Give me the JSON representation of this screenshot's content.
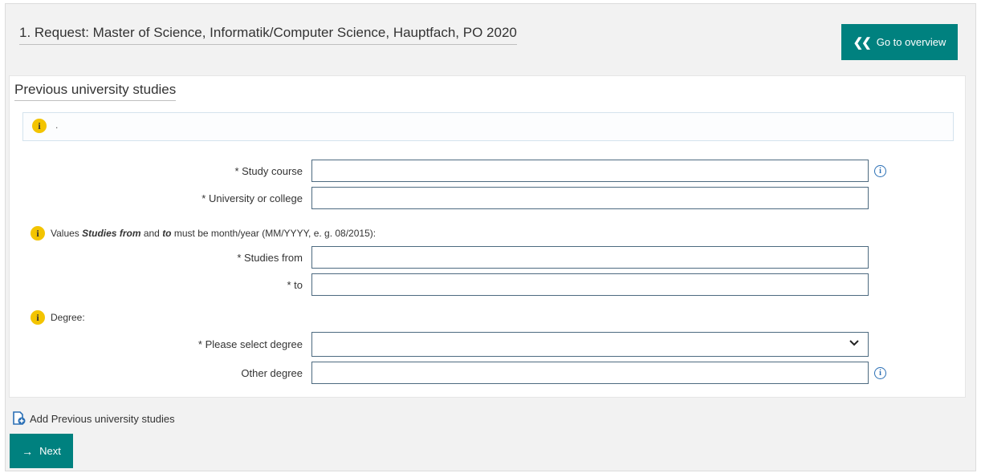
{
  "header": {
    "title": "1. Request: Master of Science, Informatik/Computer Science, Hauptfach, PO 2020",
    "overview_button": "Go to overview"
  },
  "section": {
    "title": "Previous university studies",
    "info_text": "."
  },
  "fields": {
    "study_course": {
      "label": "* Study course",
      "value": ""
    },
    "university": {
      "label": "* University or college",
      "value": ""
    },
    "studies_from": {
      "label": "* Studies from",
      "value": ""
    },
    "studies_to": {
      "label": "* to",
      "value": ""
    },
    "degree_select": {
      "label": "* Please select degree",
      "value": ""
    },
    "other_degree": {
      "label": "Other degree",
      "value": ""
    }
  },
  "notes": {
    "dates_prefix": "Values ",
    "dates_bold1": "Studies from",
    "dates_mid": " and ",
    "dates_bold2": "to",
    "dates_suffix": " must be month/year (MM/YYYY, e. g. 08/2015):",
    "degree": "Degree:"
  },
  "actions": {
    "add_label": "Add Previous university studies",
    "next_label": "Next"
  },
  "icons": {
    "overview": "double-chevron-left-icon",
    "info": "info-icon",
    "help": "help-circle-icon",
    "add": "add-document-icon",
    "next": "arrow-right-icon",
    "chevron": "chevron-down-icon"
  },
  "colors": {
    "accent": "#00817f",
    "info": "#f3c400",
    "help": "#2a6fb5"
  }
}
